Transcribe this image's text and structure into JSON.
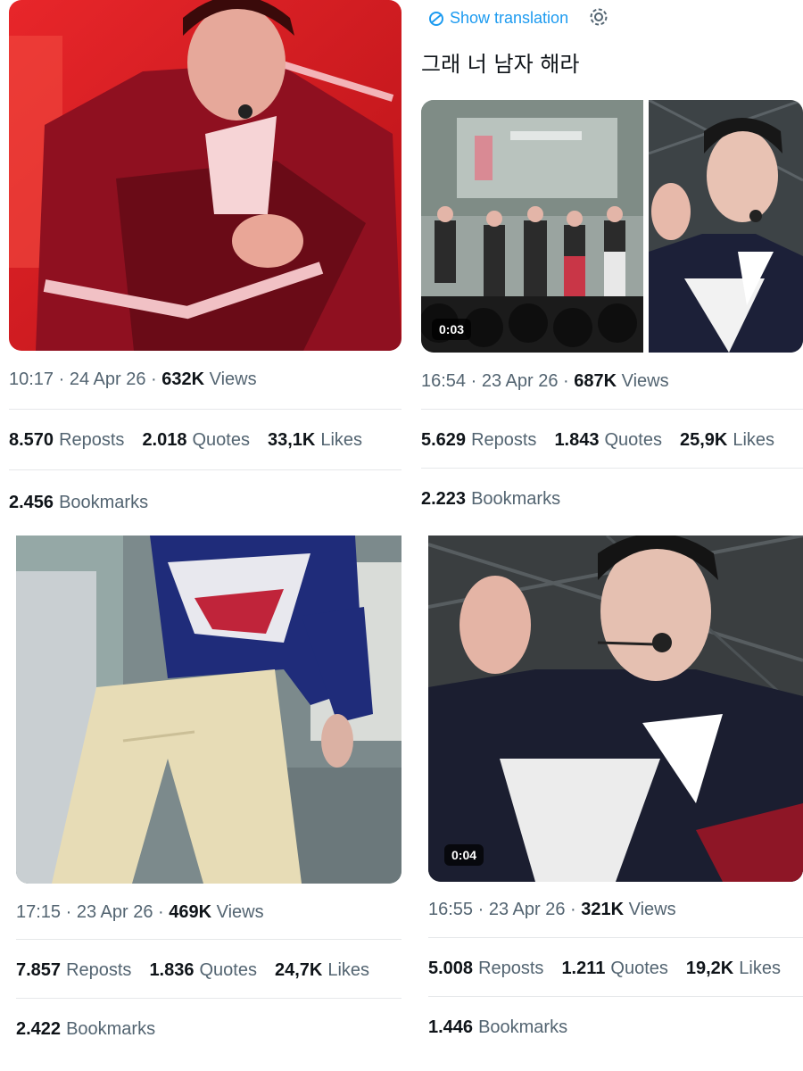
{
  "tweets": [
    {
      "time": "10:17",
      "date": "24 Apr 26",
      "views_count": "632K",
      "views_label": "Views",
      "reposts_count": "8.570",
      "reposts_label": "Reposts",
      "quotes_count": "2.018",
      "quotes_label": "Quotes",
      "likes_count": "33,1K",
      "likes_label": "Likes",
      "bookmarks_count": "2.456",
      "bookmarks_label": "Bookmarks"
    },
    {
      "translate_label": "Show translation",
      "text": "그래 너 남자 해라",
      "video_duration": "0:03",
      "time": "16:54",
      "date": "23 Apr 26",
      "views_count": "687K",
      "views_label": "Views",
      "reposts_count": "5.629",
      "reposts_label": "Reposts",
      "quotes_count": "1.843",
      "quotes_label": "Quotes",
      "likes_count": "25,9K",
      "likes_label": "Likes",
      "bookmarks_count": "2.223",
      "bookmarks_label": "Bookmarks"
    },
    {
      "time": "17:15",
      "date": "23 Apr 26",
      "views_count": "469K",
      "views_label": "Views",
      "reposts_count": "7.857",
      "reposts_label": "Reposts",
      "quotes_count": "1.836",
      "quotes_label": "Quotes",
      "likes_count": "24,7K",
      "likes_label": "Likes",
      "bookmarks_count": "2.422",
      "bookmarks_label": "Bookmarks"
    },
    {
      "video_duration": "0:04",
      "time": "16:55",
      "date": "23 Apr 26",
      "views_count": "321K",
      "views_label": "Views",
      "reposts_count": "5.008",
      "reposts_label": "Reposts",
      "quotes_count": "1.211",
      "quotes_label": "Quotes",
      "likes_count": "19,2K",
      "likes_label": "Likes",
      "bookmarks_count": "1.446",
      "bookmarks_label": "Bookmarks"
    }
  ],
  "icons": {
    "translate": "translate-icon",
    "settings": "gear-icon"
  },
  "colors": {
    "link": "#1d9bf0",
    "secondary_text": "#536471",
    "primary_text": "#0f1419",
    "divider": "#e6e8ea"
  }
}
